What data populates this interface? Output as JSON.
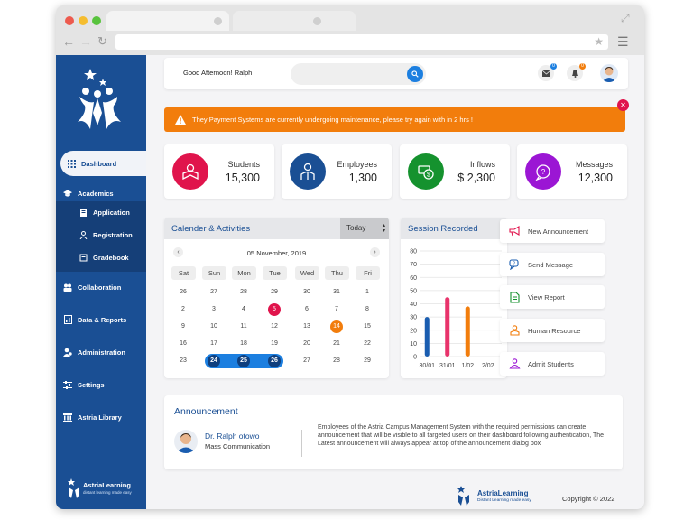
{
  "header": {
    "greeting": "Good Afternoon!  Ralph",
    "mail_badge": "0",
    "bell_badge": "0"
  },
  "alert": {
    "text": "Theу Payment Systems are currently undergoing maintenance, please try again with in 2 hrs !",
    "color": "#f27d0c"
  },
  "sidebar": {
    "items": [
      {
        "label": "Dashboard",
        "icon": "grid-icon"
      },
      {
        "label": "Academics",
        "icon": "graduation-cap-icon"
      },
      {
        "label": "Application",
        "icon": "document-icon"
      },
      {
        "label": "Registration",
        "icon": "user-icon"
      },
      {
        "label": "Gradebook",
        "icon": "book-icon"
      },
      {
        "label": "Collaboration",
        "icon": "people-icon"
      },
      {
        "label": "Data & Reports",
        "icon": "report-icon"
      },
      {
        "label": "Administration",
        "icon": "admin-icon"
      },
      {
        "label": "Settings",
        "icon": "sliders-icon"
      },
      {
        "label": "Astria Library",
        "icon": "library-icon"
      }
    ],
    "logo_name": "AstriaLearning",
    "logo_tagline": "distant learning made easy"
  },
  "stats": [
    {
      "label": "Students",
      "value": "15,300",
      "color": "#e0144c",
      "icon": "student-icon"
    },
    {
      "label": "Employees",
      "value": "1,300",
      "color": "#1a4f94",
      "icon": "employee-icon"
    },
    {
      "label": "Inflows",
      "value": "$ 2,300",
      "color": "#15922e",
      "icon": "money-icon"
    },
    {
      "label": "Messages",
      "value": "12,300",
      "color": "#9b16d4",
      "icon": "message-icon"
    }
  ],
  "calendar": {
    "title": "Calender & Activities",
    "today_label": "Today",
    "month": "05 November, 2019",
    "weekdays": [
      "Sat",
      "Sun",
      "Mon",
      "Tue",
      "Wed",
      "Thu",
      "Fri"
    ],
    "weeks": [
      [
        "26",
        "27",
        "28",
        "29",
        "30",
        "31",
        "1"
      ],
      [
        "2",
        "3",
        "4",
        "5",
        "6",
        "7",
        "8"
      ],
      [
        "9",
        "10",
        "11",
        "12",
        "13",
        "14",
        "15"
      ],
      [
        "16",
        "17",
        "18",
        "19",
        "20",
        "21",
        "22"
      ],
      [
        "23",
        "24",
        "25",
        "26",
        "27",
        "28",
        "29"
      ]
    ]
  },
  "chart_data": {
    "type": "bar",
    "title": "Session Recorded",
    "categories": [
      "30/01",
      "31/01",
      "1/02",
      "2/02"
    ],
    "values": [
      30,
      45,
      38,
      null
    ],
    "colors": [
      "#1a5db0",
      "#e8336b",
      "#f27d0c"
    ],
    "ylim": [
      0,
      80
    ],
    "yticks": [
      0,
      10,
      20,
      30,
      40,
      50,
      60,
      70,
      80
    ],
    "grid": true
  },
  "quick_actions": [
    {
      "label": "New Announcement",
      "icon": "megaphone-icon"
    },
    {
      "label": "Send Message",
      "icon": "chat-icon"
    },
    {
      "label": "View Report",
      "icon": "file-icon"
    },
    {
      "label": "Human Resource",
      "icon": "people-icon"
    },
    {
      "label": "Admit Students",
      "icon": "admit-icon"
    }
  ],
  "announcement": {
    "title": "Announcement",
    "name": "Dr. Ralph otowo",
    "role": "Mass Communication",
    "text": "Employees of the Astria Campus Management System with the required permissions can create announcement that will be visible to all targeted users on their dashboard following authentication, The Latest announcement will always appear at top of the announcement dialog box"
  },
  "footer": {
    "brand": "AstriaLearning",
    "tagline": "Distant Learning made easy",
    "copyright": "Copyright © 2022"
  }
}
